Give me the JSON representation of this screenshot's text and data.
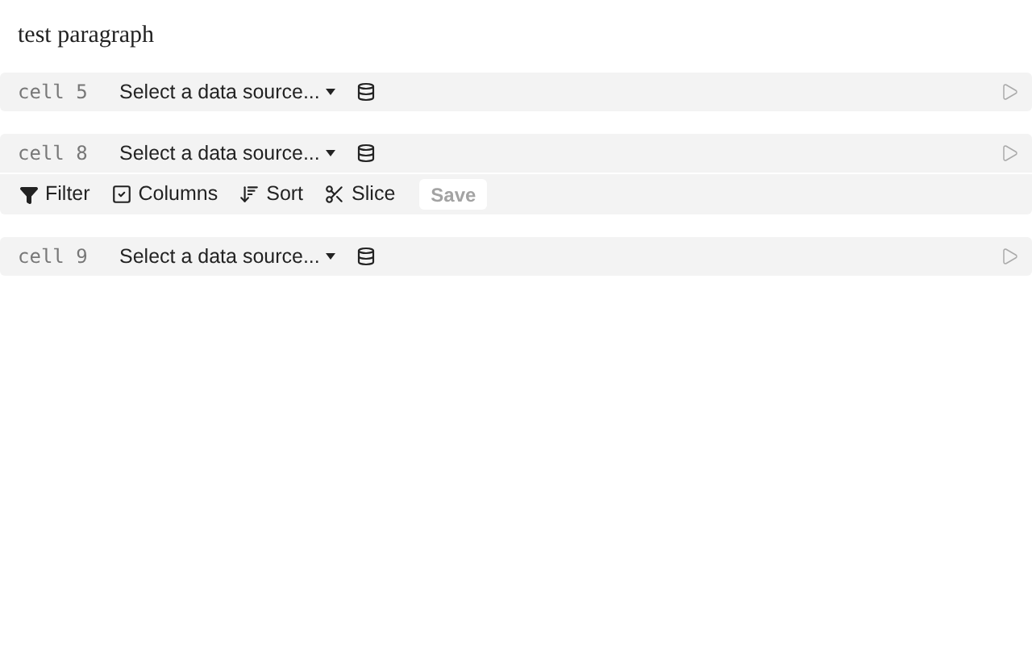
{
  "paragraph": "test paragraph",
  "cells": [
    {
      "label": "cell 5",
      "source": "Select a data source..."
    },
    {
      "label": "cell 8",
      "source": "Select a data source...",
      "toolbar": {
        "tools": [
          {
            "kind": "filter",
            "label": "Filter"
          },
          {
            "kind": "columns",
            "label": "Columns"
          },
          {
            "kind": "sort",
            "label": "Sort"
          },
          {
            "kind": "slice",
            "label": "Slice"
          }
        ],
        "save": {
          "label": "Save",
          "disabled": true
        }
      }
    },
    {
      "label": "cell 9",
      "source": "Select a data source..."
    }
  ]
}
